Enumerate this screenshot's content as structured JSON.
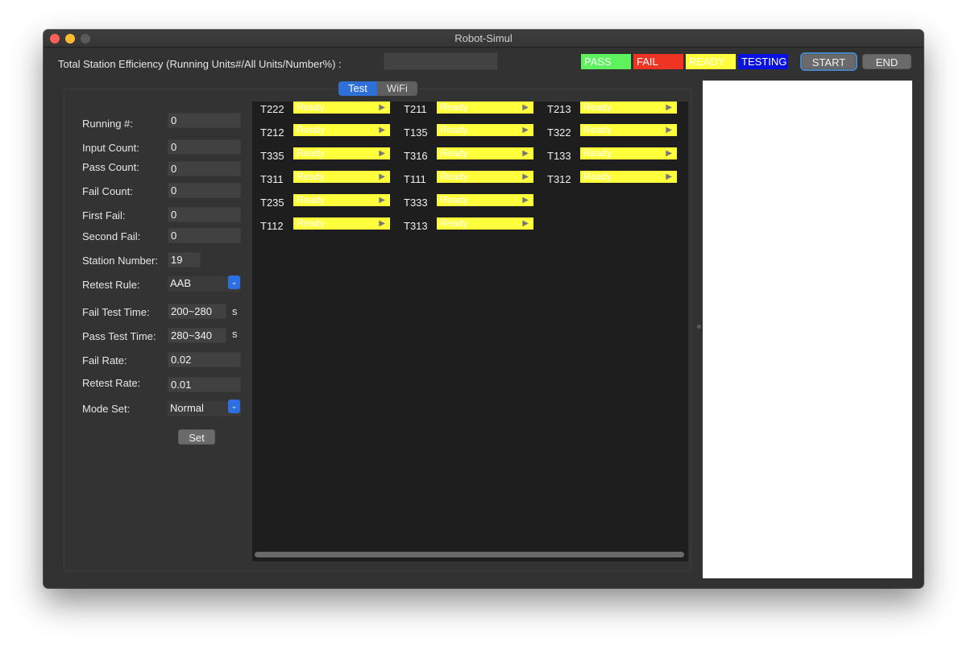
{
  "window": {
    "title": "Robot-Simul"
  },
  "efficiency": {
    "label": "Total Station Efficiency (Running Units#/All Units/Number%) :",
    "value": ""
  },
  "legend": {
    "pass": "PASS",
    "fail": "FAIL",
    "ready": "READY",
    "testing": "TESTING"
  },
  "buttons": {
    "start": "START",
    "end": "END",
    "set": "Set"
  },
  "tabs": [
    {
      "label": "Test",
      "active": true
    },
    {
      "label": "WiFi",
      "active": false
    }
  ],
  "form": {
    "running": {
      "label": "Running #:",
      "value": "0"
    },
    "input_count": {
      "label": "Input Count:",
      "value": "0"
    },
    "pass_count": {
      "label": "Pass Count:",
      "value": "0"
    },
    "fail_count": {
      "label": "Fail Count:",
      "value": "0"
    },
    "first_fail": {
      "label": "First Fail:",
      "value": "0"
    },
    "second_fail": {
      "label": "Second Fail:",
      "value": "0"
    },
    "station_number": {
      "label": "Station Number:",
      "value": "19"
    },
    "retest_rule": {
      "label": "Retest Rule:",
      "value": "AAB"
    },
    "fail_test_time": {
      "label": "Fail Test Time:",
      "value": "200~280",
      "unit": "s"
    },
    "pass_test_time": {
      "label": "Pass Test Time:",
      "value": "280~340",
      "unit": "s"
    },
    "fail_rate": {
      "label": "Fail Rate:",
      "value": "0.02"
    },
    "retest_rate": {
      "label": "Retest Rate:",
      "value": "0.01"
    },
    "mode_set": {
      "label": "Mode Set:",
      "value": "Normal"
    }
  },
  "stations": {
    "col1": [
      {
        "name": "T222",
        "status": "Ready"
      },
      {
        "name": "T212",
        "status": "Ready"
      },
      {
        "name": "T335",
        "status": "Ready"
      },
      {
        "name": "T311",
        "status": "Ready"
      },
      {
        "name": "T235",
        "status": "Ready"
      },
      {
        "name": "T112",
        "status": "Ready"
      }
    ],
    "col2": [
      {
        "name": "T211",
        "status": "Ready"
      },
      {
        "name": "T135",
        "status": "Ready"
      },
      {
        "name": "T316",
        "status": "Ready"
      },
      {
        "name": "T111",
        "status": "Ready"
      },
      {
        "name": "T333",
        "status": "Ready"
      },
      {
        "name": "T313",
        "status": "Ready"
      }
    ],
    "col3": [
      {
        "name": "T213",
        "status": "Ready"
      },
      {
        "name": "T322",
        "status": "Ready"
      },
      {
        "name": "T133",
        "status": "Ready"
      },
      {
        "name": "T312",
        "status": "Ready"
      }
    ]
  },
  "colors": {
    "ready": "#ffff3c",
    "pass": "#5cf35c",
    "fail": "#ee3423",
    "testing": "#0a12e0",
    "accent": "#2f6fd8"
  }
}
